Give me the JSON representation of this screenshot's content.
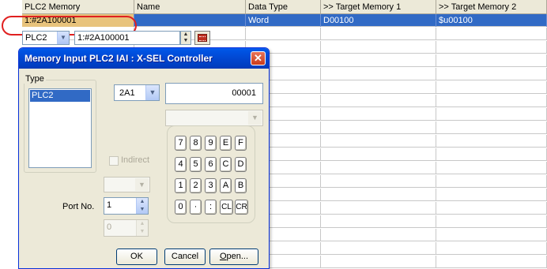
{
  "grid": {
    "headers": [
      "PLC2 Memory",
      "Name",
      "Data Type",
      ">> Target Memory 1",
      ">> Target Memory 2"
    ],
    "selected_row": [
      "1:#2A100001",
      "",
      "Word",
      "D00100",
      "$u00100"
    ],
    "empty_rows": 18
  },
  "editor": {
    "plc": "PLC2",
    "address": "1:#2A100001",
    "spin_up": "▲",
    "spin_down": "▼"
  },
  "dialog": {
    "title": "Memory Input  PLC2 IAI : X-SEL Controller",
    "close": "✕",
    "type_legend": "Type",
    "type_items": [
      "PLC2"
    ],
    "device_select": "2A1",
    "value": "00001",
    "indirect_label": "Indirect",
    "port_label": "Port No.",
    "port_value": "1",
    "port_value2": "0",
    "keys": [
      [
        "7",
        "8",
        "9",
        "E",
        "F"
      ],
      [
        "4",
        "5",
        "6",
        "C",
        "D"
      ],
      [
        "1",
        "2",
        "3",
        "A",
        "B"
      ],
      [
        "0",
        "·",
        ":",
        "CL",
        "CR"
      ]
    ],
    "buttons": {
      "ok": "OK",
      "cancel": "Cancel",
      "open": "Open..."
    }
  },
  "colors": {
    "selection": "#316ac5",
    "title": "#0147d1",
    "highlight": "#e02020"
  }
}
